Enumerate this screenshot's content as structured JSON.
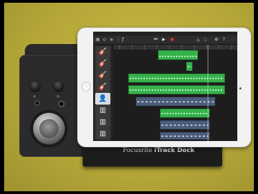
{
  "scene": {
    "brand_name": "Focusrite",
    "product_name": "iTrack Dock"
  },
  "tracks": [
    {
      "icon": "🎸",
      "name_icon": "guitar-icon",
      "selected": false
    },
    {
      "icon": "🎸",
      "name_icon": "guitar-icon",
      "selected": false
    },
    {
      "icon": "🎸",
      "name_icon": "guitar-icon",
      "selected": false
    },
    {
      "icon": "🎸",
      "name_icon": "guitar-icon",
      "selected": false
    },
    {
      "icon": "👤",
      "name_icon": "person-icon",
      "selected": true
    },
    {
      "icon": "▥",
      "name_icon": "drum-machine-icon",
      "selected": false
    },
    {
      "icon": "▥",
      "name_icon": "drum-machine-icon",
      "selected": false
    },
    {
      "icon": "▥",
      "name_icon": "drum-machine-icon",
      "selected": false
    }
  ],
  "colors": {
    "region_green": "#36b24b",
    "region_blue": "#4b5d7a",
    "record_red": "#e5342a",
    "wall": "#b8aa3a"
  }
}
